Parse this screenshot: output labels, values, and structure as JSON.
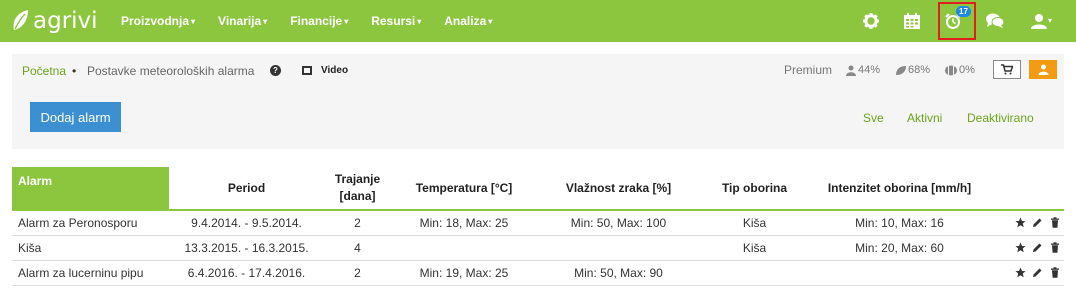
{
  "brand": {
    "name": "agrivi"
  },
  "nav": {
    "menu": [
      {
        "label": "Proizvodnja"
      },
      {
        "label": "Vinarija"
      },
      {
        "label": "Financije"
      },
      {
        "label": "Resursi"
      },
      {
        "label": "Analiza"
      }
    ],
    "icons": [
      "gear-icon",
      "calendar-icon",
      "alarm-clock-icon",
      "chat-icon",
      "user-icon"
    ],
    "alarm_badge": "17"
  },
  "breadcrumb": {
    "home": "Početna",
    "separator": "•",
    "current": "Postavke meteoroloških alarma",
    "video_label": "Video"
  },
  "account": {
    "plan": "Premium",
    "stats": [
      "44%",
      "68%",
      "0%"
    ]
  },
  "toolbar": {
    "add_label": "Dodaj alarm",
    "filters": [
      "Sve",
      "Aktivni",
      "Deaktivirano"
    ]
  },
  "table": {
    "headers": {
      "alarm": "Alarm",
      "period": "Period",
      "duration_line1": "Trajanje",
      "duration_line2": "[dana]",
      "temperature": "Temperatura [°C]",
      "humidity": "Vlažnost zraka [%]",
      "precip_type": "Tip oborina",
      "precip_intensity": "Intenzitet oborina [mm/h]"
    },
    "rows": [
      {
        "name": "Alarm za Peronosporu",
        "period": "9.4.2014. - 9.5.2014.",
        "duration": "2",
        "temperature": "Min: 18, Max: 25",
        "humidity": "Min: 50, Max: 100",
        "precip_type": "Kiša",
        "precip_intensity": "Min: 10, Max: 16"
      },
      {
        "name": "Kiša",
        "period": "13.3.2015. - 16.3.2015.",
        "duration": "4",
        "temperature": "",
        "humidity": "",
        "precip_type": "Kiša",
        "precip_intensity": "Min: 20, Max: 60"
      },
      {
        "name": "Alarm za lucerninu pipu",
        "period": "6.4.2016. - 17.4.2016.",
        "duration": "2",
        "temperature": "Min: 19, Max: 25",
        "humidity": "Min: 50, Max: 90",
        "precip_type": "",
        "precip_intensity": ""
      }
    ]
  },
  "colors": {
    "brand_green": "#8cc63f",
    "link_green": "#6aa51c",
    "button_blue": "#3c8fd0",
    "highlight_red": "#e21e1e",
    "badge_blue": "#1e88e5",
    "user_orange": "#f39c12"
  }
}
